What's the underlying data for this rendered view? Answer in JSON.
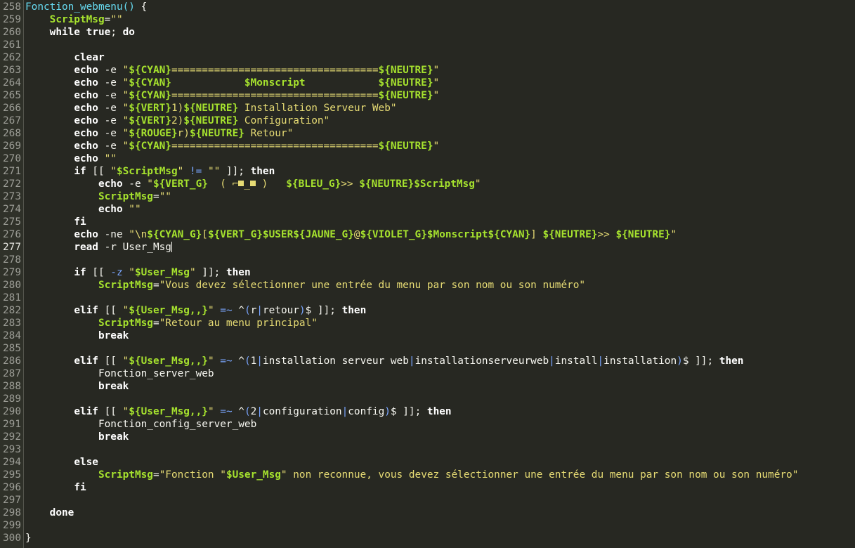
{
  "editor": {
    "current_line": 277,
    "colors": {
      "background": "#272822",
      "gutter": "#2f3129",
      "keyword": "#ffffff",
      "string": "#e6db74",
      "variable": "#a6e22e",
      "function": "#66d9ef",
      "operator": "#7aa6ff"
    }
  },
  "lines": [
    {
      "n": "258",
      "t": [
        [
          "fn",
          "Fonction_webmenu() "
        ],
        [
          "pl",
          "{"
        ]
      ]
    },
    {
      "n": "259",
      "t": [
        [
          "pl",
          "    "
        ],
        [
          "v",
          "ScriptMsg"
        ],
        [
          "pl",
          "="
        ],
        [
          "str",
          "\"\""
        ]
      ]
    },
    {
      "n": "260",
      "t": [
        [
          "pl",
          "    "
        ],
        [
          "kw",
          "while"
        ],
        [
          "pl",
          " "
        ],
        [
          "kw",
          "true"
        ],
        [
          "pl",
          "; "
        ],
        [
          "kw",
          "do"
        ]
      ]
    },
    {
      "n": "261",
      "t": []
    },
    {
      "n": "262",
      "t": [
        [
          "pl",
          "        "
        ],
        [
          "kw",
          "clear"
        ]
      ]
    },
    {
      "n": "263",
      "t": [
        [
          "pl",
          "        "
        ],
        [
          "kw",
          "echo"
        ],
        [
          "pl",
          " -e "
        ],
        [
          "str",
          "\""
        ],
        [
          "v",
          "${CYAN}"
        ],
        [
          "str",
          "=================================="
        ],
        [
          "v",
          "${NEUTRE}"
        ],
        [
          "str",
          "\""
        ]
      ]
    },
    {
      "n": "264",
      "t": [
        [
          "pl",
          "        "
        ],
        [
          "kw",
          "echo"
        ],
        [
          "pl",
          " -e "
        ],
        [
          "str",
          "\""
        ],
        [
          "v",
          "${CYAN}"
        ],
        [
          "str",
          "            "
        ],
        [
          "v",
          "$Monscript"
        ],
        [
          "str",
          "            "
        ],
        [
          "v",
          "${NEUTRE}"
        ],
        [
          "str",
          "\""
        ]
      ]
    },
    {
      "n": "265",
      "t": [
        [
          "pl",
          "        "
        ],
        [
          "kw",
          "echo"
        ],
        [
          "pl",
          " -e "
        ],
        [
          "str",
          "\""
        ],
        [
          "v",
          "${CYAN}"
        ],
        [
          "str",
          "=================================="
        ],
        [
          "v",
          "${NEUTRE}"
        ],
        [
          "str",
          "\""
        ]
      ]
    },
    {
      "n": "266",
      "t": [
        [
          "pl",
          "        "
        ],
        [
          "kw",
          "echo"
        ],
        [
          "pl",
          " -e "
        ],
        [
          "str",
          "\""
        ],
        [
          "v",
          "${VERT}"
        ],
        [
          "str",
          "1)"
        ],
        [
          "v",
          "${NEUTRE}"
        ],
        [
          "str",
          " Installation Serveur Web\""
        ]
      ]
    },
    {
      "n": "267",
      "t": [
        [
          "pl",
          "        "
        ],
        [
          "kw",
          "echo"
        ],
        [
          "pl",
          " -e "
        ],
        [
          "str",
          "\""
        ],
        [
          "v",
          "${VERT}"
        ],
        [
          "str",
          "2)"
        ],
        [
          "v",
          "${NEUTRE}"
        ],
        [
          "str",
          " Configuration\""
        ]
      ]
    },
    {
      "n": "268",
      "t": [
        [
          "pl",
          "        "
        ],
        [
          "kw",
          "echo"
        ],
        [
          "pl",
          " -e "
        ],
        [
          "str",
          "\""
        ],
        [
          "v",
          "${ROUGE}"
        ],
        [
          "str",
          "r)"
        ],
        [
          "v",
          "${NEUTRE}"
        ],
        [
          "str",
          " Retour\""
        ]
      ]
    },
    {
      "n": "269",
      "t": [
        [
          "pl",
          "        "
        ],
        [
          "kw",
          "echo"
        ],
        [
          "pl",
          " -e "
        ],
        [
          "str",
          "\""
        ],
        [
          "v",
          "${CYAN}"
        ],
        [
          "str",
          "=================================="
        ],
        [
          "v",
          "${NEUTRE}"
        ],
        [
          "str",
          "\""
        ]
      ]
    },
    {
      "n": "270",
      "t": [
        [
          "pl",
          "        "
        ],
        [
          "kw",
          "echo"
        ],
        [
          "pl",
          " "
        ],
        [
          "str",
          "\"\""
        ]
      ]
    },
    {
      "n": "271",
      "t": [
        [
          "pl",
          "        "
        ],
        [
          "kw",
          "if"
        ],
        [
          "pl",
          " [[ "
        ],
        [
          "str",
          "\""
        ],
        [
          "v",
          "$ScriptMsg"
        ],
        [
          "str",
          "\""
        ],
        [
          "pl",
          " "
        ],
        [
          "op",
          "!="
        ],
        [
          "pl",
          " "
        ],
        [
          "str",
          "\"\""
        ],
        [
          "pl",
          " ]]; "
        ],
        [
          "kw",
          "then"
        ]
      ]
    },
    {
      "n": "272",
      "t": [
        [
          "pl",
          "            "
        ],
        [
          "kw",
          "echo"
        ],
        [
          "pl",
          " -e "
        ],
        [
          "str",
          "\""
        ],
        [
          "v",
          "${VERT_G}"
        ],
        [
          "str",
          "  ( ⌐"
        ],
        [
          "blk",
          ""
        ],
        [
          "str",
          "_"
        ],
        [
          "blk",
          ""
        ],
        [
          "str",
          " )   "
        ],
        [
          "v",
          "${BLEU_G}"
        ],
        [
          "str",
          ">> "
        ],
        [
          "v",
          "${NEUTRE}$ScriptMsg"
        ],
        [
          "str",
          "\""
        ]
      ]
    },
    {
      "n": "273",
      "t": [
        [
          "pl",
          "            "
        ],
        [
          "v",
          "ScriptMsg"
        ],
        [
          "pl",
          "="
        ],
        [
          "str",
          "\"\""
        ]
      ]
    },
    {
      "n": "274",
      "t": [
        [
          "pl",
          "            "
        ],
        [
          "kw",
          "echo"
        ],
        [
          "pl",
          " "
        ],
        [
          "str",
          "\"\""
        ]
      ]
    },
    {
      "n": "275",
      "t": [
        [
          "pl",
          "        "
        ],
        [
          "kw",
          "fi"
        ]
      ]
    },
    {
      "n": "276",
      "t": [
        [
          "pl",
          "        "
        ],
        [
          "kw",
          "echo"
        ],
        [
          "pl",
          " -ne "
        ],
        [
          "str",
          "\"\\n"
        ],
        [
          "v",
          "${CYAN_G}"
        ],
        [
          "str",
          "["
        ],
        [
          "v",
          "${VERT_G}$USER${JAUNE_G}"
        ],
        [
          "str",
          "@"
        ],
        [
          "v",
          "${VIOLET_G}$Monscript${CYAN}"
        ],
        [
          "str",
          "] "
        ],
        [
          "v",
          "${NEUTRE}"
        ],
        [
          "str",
          ">> "
        ],
        [
          "v",
          "${NEUTRE}"
        ],
        [
          "str",
          "\""
        ]
      ]
    },
    {
      "n": "277",
      "t": [
        [
          "pl",
          "        "
        ],
        [
          "kw",
          "read"
        ],
        [
          "pl",
          " -r User_Msg"
        ],
        [
          "caret",
          ""
        ]
      ]
    },
    {
      "n": "278",
      "t": []
    },
    {
      "n": "279",
      "t": [
        [
          "pl",
          "        "
        ],
        [
          "kw",
          "if"
        ],
        [
          "pl",
          " [[ "
        ],
        [
          "op",
          "-z"
        ],
        [
          "pl",
          " "
        ],
        [
          "str",
          "\""
        ],
        [
          "v",
          "$User_Msg"
        ],
        [
          "str",
          "\""
        ],
        [
          "pl",
          " ]]; "
        ],
        [
          "kw",
          "then"
        ]
      ]
    },
    {
      "n": "280",
      "t": [
        [
          "pl",
          "            "
        ],
        [
          "v",
          "ScriptMsg"
        ],
        [
          "pl",
          "="
        ],
        [
          "str",
          "\"Vous devez sélectionner une entrée du menu par son nom ou son numéro\""
        ]
      ]
    },
    {
      "n": "281",
      "t": []
    },
    {
      "n": "282",
      "t": [
        [
          "pl",
          "        "
        ],
        [
          "kw",
          "elif"
        ],
        [
          "pl",
          " [[ "
        ],
        [
          "str",
          "\""
        ],
        [
          "v",
          "${User_Msg,,}"
        ],
        [
          "str",
          "\""
        ],
        [
          "pl",
          " "
        ],
        [
          "op",
          "=~"
        ],
        [
          "pl",
          " ^"
        ],
        [
          "op",
          "("
        ],
        [
          "pl",
          "r"
        ],
        [
          "op",
          "|"
        ],
        [
          "pl",
          "retour"
        ],
        [
          "op",
          ")"
        ],
        [
          "pl",
          "$ ]]; "
        ],
        [
          "kw",
          "then"
        ]
      ]
    },
    {
      "n": "283",
      "t": [
        [
          "pl",
          "            "
        ],
        [
          "v",
          "ScriptMsg"
        ],
        [
          "pl",
          "="
        ],
        [
          "str",
          "\"Retour au menu principal\""
        ]
      ]
    },
    {
      "n": "284",
      "t": [
        [
          "pl",
          "            "
        ],
        [
          "kw",
          "break"
        ]
      ]
    },
    {
      "n": "285",
      "t": []
    },
    {
      "n": "286",
      "t": [
        [
          "pl",
          "        "
        ],
        [
          "kw",
          "elif"
        ],
        [
          "pl",
          " [[ "
        ],
        [
          "str",
          "\""
        ],
        [
          "v",
          "${User_Msg,,}"
        ],
        [
          "str",
          "\""
        ],
        [
          "pl",
          " "
        ],
        [
          "op",
          "=~"
        ],
        [
          "pl",
          " ^"
        ],
        [
          "op",
          "("
        ],
        [
          "pl",
          "1"
        ],
        [
          "op",
          "|"
        ],
        [
          "pl",
          "installation serveur web"
        ],
        [
          "op",
          "|"
        ],
        [
          "pl",
          "installationserveurweb"
        ],
        [
          "op",
          "|"
        ],
        [
          "pl",
          "install"
        ],
        [
          "op",
          "|"
        ],
        [
          "pl",
          "installation"
        ],
        [
          "op",
          ")"
        ],
        [
          "pl",
          "$ ]]; "
        ],
        [
          "kw",
          "then"
        ]
      ]
    },
    {
      "n": "287",
      "t": [
        [
          "pl",
          "            Fonction_server_web"
        ]
      ]
    },
    {
      "n": "288",
      "t": [
        [
          "pl",
          "            "
        ],
        [
          "kw",
          "break"
        ]
      ]
    },
    {
      "n": "289",
      "t": []
    },
    {
      "n": "290",
      "t": [
        [
          "pl",
          "        "
        ],
        [
          "kw",
          "elif"
        ],
        [
          "pl",
          " [[ "
        ],
        [
          "str",
          "\""
        ],
        [
          "v",
          "${User_Msg,,}"
        ],
        [
          "str",
          "\""
        ],
        [
          "pl",
          " "
        ],
        [
          "op",
          "=~"
        ],
        [
          "pl",
          " ^"
        ],
        [
          "op",
          "("
        ],
        [
          "pl",
          "2"
        ],
        [
          "op",
          "|"
        ],
        [
          "pl",
          "configuration"
        ],
        [
          "op",
          "|"
        ],
        [
          "pl",
          "config"
        ],
        [
          "op",
          ")"
        ],
        [
          "pl",
          "$ ]]; "
        ],
        [
          "kw",
          "then"
        ]
      ]
    },
    {
      "n": "291",
      "t": [
        [
          "pl",
          "            Fonction_config_server_web"
        ]
      ]
    },
    {
      "n": "292",
      "t": [
        [
          "pl",
          "            "
        ],
        [
          "kw",
          "break"
        ]
      ]
    },
    {
      "n": "293",
      "t": []
    },
    {
      "n": "294",
      "t": [
        [
          "pl",
          "        "
        ],
        [
          "kw",
          "else"
        ]
      ]
    },
    {
      "n": "295",
      "t": [
        [
          "pl",
          "            "
        ],
        [
          "v",
          "ScriptMsg"
        ],
        [
          "pl",
          "="
        ],
        [
          "str",
          "\"Fonction \""
        ],
        [
          "v",
          "$User_Msg"
        ],
        [
          "str",
          "\" non reconnue, vous devez sélectionner une entrée du menu par son nom ou son numéro\""
        ]
      ]
    },
    {
      "n": "296",
      "t": [
        [
          "pl",
          "        "
        ],
        [
          "kw",
          "fi"
        ]
      ]
    },
    {
      "n": "297",
      "t": []
    },
    {
      "n": "298",
      "t": [
        [
          "pl",
          "    "
        ],
        [
          "kw",
          "done"
        ]
      ]
    },
    {
      "n": "299",
      "t": []
    },
    {
      "n": "300",
      "t": [
        [
          "pl",
          "}"
        ]
      ]
    }
  ]
}
